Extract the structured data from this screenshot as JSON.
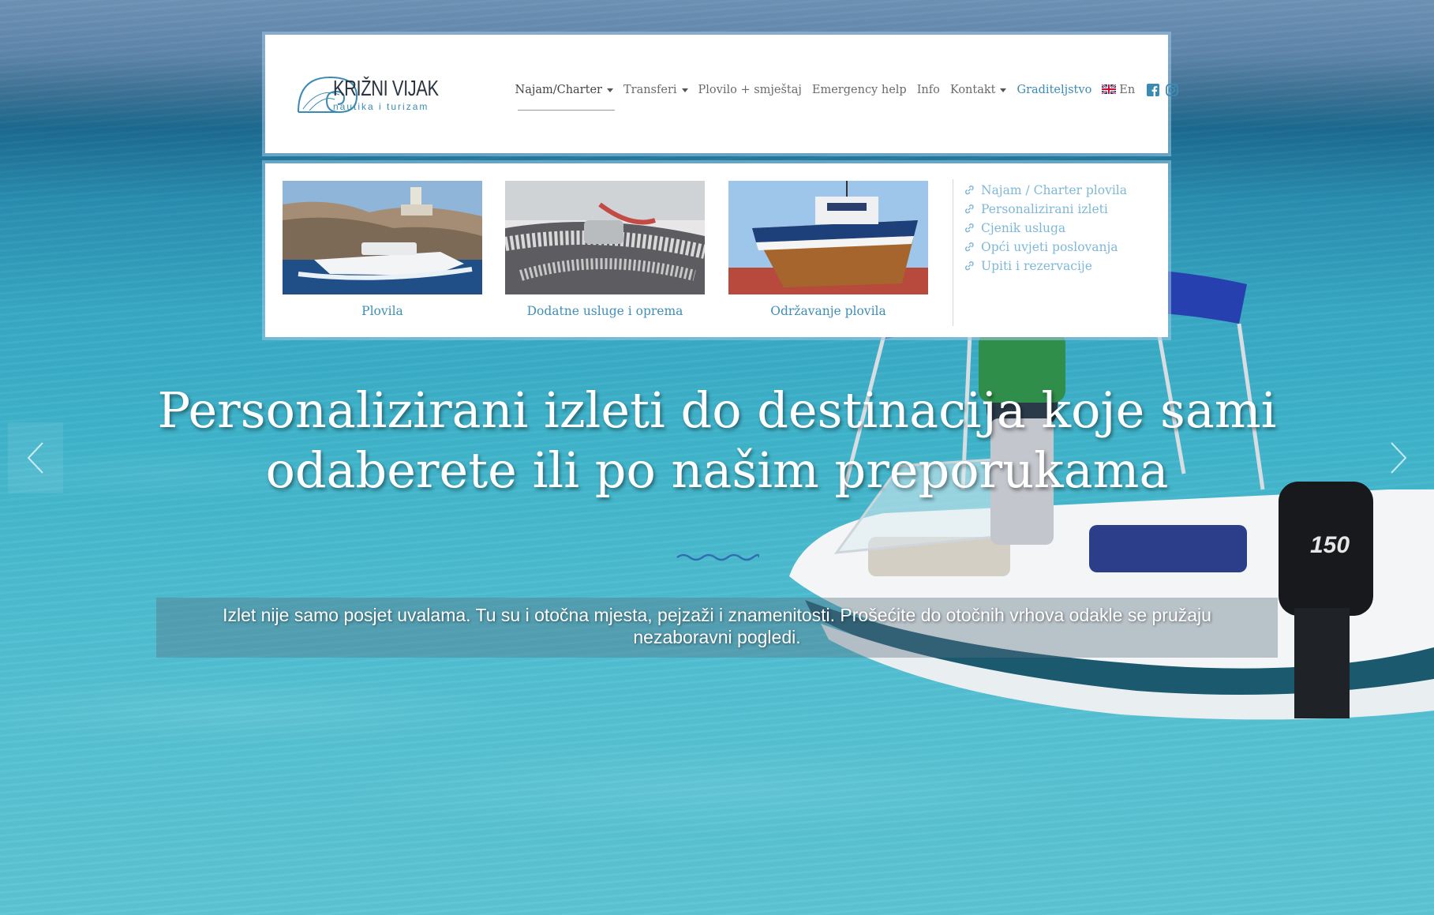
{
  "brand": {
    "title": "KRIŽNI VIJAK",
    "subtitle": "nautika i turizam"
  },
  "nav": {
    "items": [
      {
        "label": "Najam/Charter",
        "dropdown": true
      },
      {
        "label": "Transferi",
        "dropdown": true
      },
      {
        "label": "Plovilo + smještaj",
        "dropdown": false
      },
      {
        "label": "Emergency help",
        "dropdown": false
      },
      {
        "label": "Info",
        "dropdown": false
      },
      {
        "label": "Kontakt",
        "dropdown": true
      },
      {
        "label": "Graditeljstvo",
        "dropdown": false
      }
    ],
    "language": "En",
    "social": [
      "facebook-icon",
      "instagram-icon"
    ],
    "accent_color": "#3a8bb3"
  },
  "dropdown": {
    "cards": [
      {
        "caption": "Plovila"
      },
      {
        "caption": "Dodatne usluge i oprema"
      },
      {
        "caption": "Održavanje plovila"
      }
    ],
    "links": [
      "Najam / Charter plovila",
      "Personalizirani izleti",
      "Cjenik usluga",
      "Opći uvjeti poslovanja",
      "Upiti i rezervacije"
    ]
  },
  "hero": {
    "title_line1": "Personalizirani izleti do destinacija koje sami",
    "title_line2": "odaberete ili po našim preporukama",
    "subtitle_line1": "Izlet nije samo posjet uvalama. Tu su i otočna mjesta, pejzaži i znamenitosti. Prošećite do otočnih vrhova odakle se pružaju",
    "subtitle_line2": "nezaboravni pogledi."
  }
}
